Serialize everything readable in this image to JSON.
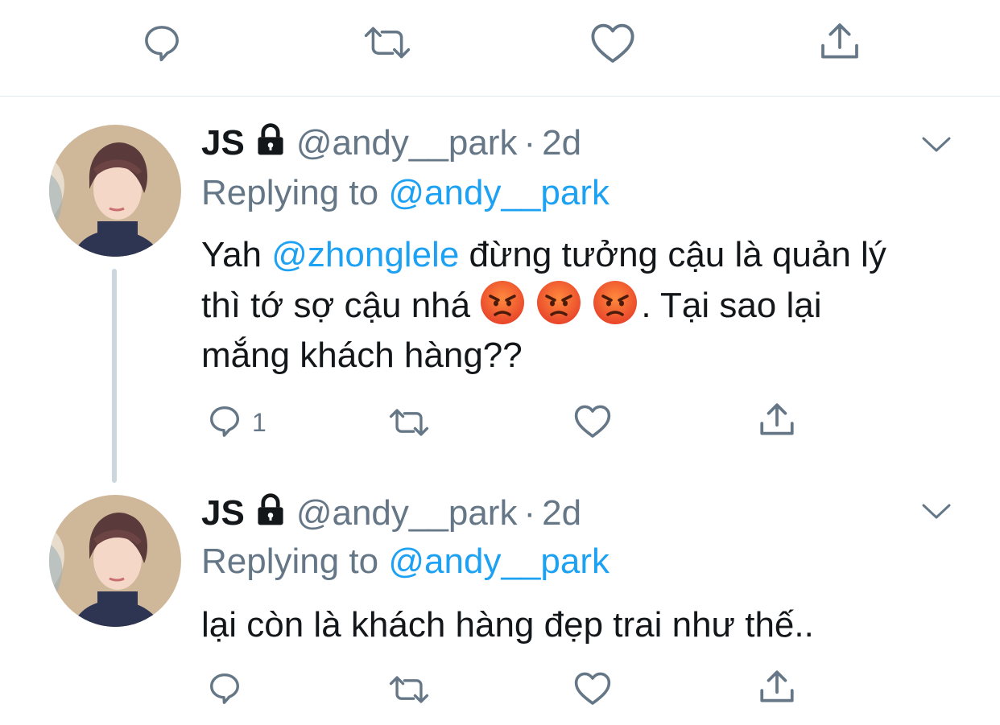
{
  "top_actions": [
    {
      "icon": "reply-icon"
    },
    {
      "icon": "retweet-icon"
    },
    {
      "icon": "like-icon"
    },
    {
      "icon": "share-icon"
    }
  ],
  "colors": {
    "text": "#14171a",
    "secondary": "#657786",
    "link": "#1da1f2",
    "divider": "#e1e8ed",
    "thread_line": "#ccd6dd"
  },
  "tweets": [
    {
      "display_name": "JS",
      "protected_icon": "lock-icon",
      "handle": "@andy__park",
      "separator": "·",
      "time": "2d",
      "replying_prefix": "Replying to",
      "replying_to": "@andy__park",
      "text_before_mention": "Yah ",
      "mention": "@zhonglele",
      "text_line1_rest": " đừng tưởng cậu là quản lý",
      "text_line2": "thì tớ sợ cậu nhá ",
      "emojis": [
        "pouting-face-emoji",
        "pouting-face-emoji",
        "pouting-face-emoji"
      ],
      "text_line2_end": ". Tại sao lại",
      "text_line3": "mắng khách hàng??",
      "reply_count": "1"
    },
    {
      "display_name": "JS",
      "protected_icon": "lock-icon",
      "handle": "@andy__park",
      "separator": "·",
      "time": "2d",
      "replying_prefix": "Replying to",
      "replying_to": "@andy__park",
      "text": "lại còn là khách hàng đẹp trai như thế..",
      "reply_count": ""
    }
  ]
}
